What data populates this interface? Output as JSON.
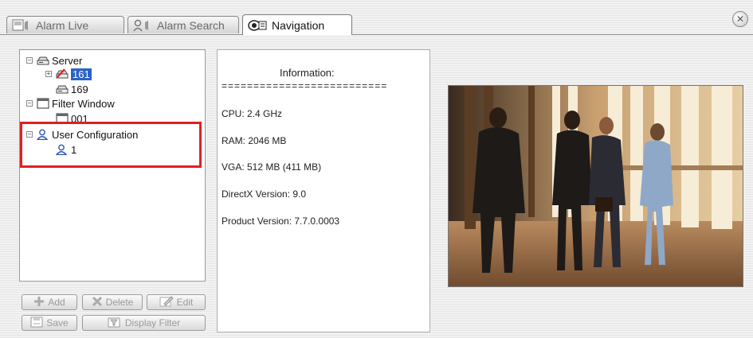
{
  "tabs": [
    {
      "label": "Alarm Live",
      "icon": "alarm-live-icon",
      "active": false
    },
    {
      "label": "Alarm Search",
      "icon": "alarm-search-icon",
      "active": false
    },
    {
      "label": "Navigation",
      "icon": "navigation-icon",
      "active": true
    }
  ],
  "close_icon": "close-icon",
  "tree": {
    "server": {
      "label": "Server",
      "children": [
        "161",
        "169"
      ],
      "selected": "161"
    },
    "filter_window": {
      "label": "Filter Window",
      "children": [
        "001"
      ]
    },
    "user_configuration": {
      "label": "User Configuration",
      "children": [
        "1"
      ]
    }
  },
  "buttons": {
    "add": "Add",
    "delete": "Delete",
    "edit": "Edit",
    "save": "Save",
    "display_filter": "Display Filter"
  },
  "info": {
    "heading": "Information:",
    "separator": "==========================",
    "cpu": "CPU: 2.4 GHz",
    "ram": "RAM: 2046 MB",
    "vga": "VGA: 512 MB (411 MB)",
    "directx": "DirectX Version: 9.0",
    "product": "Product Version: 7.7.0.0003"
  },
  "colors": {
    "highlight": "#e02020",
    "selection": "#2a63c8"
  }
}
